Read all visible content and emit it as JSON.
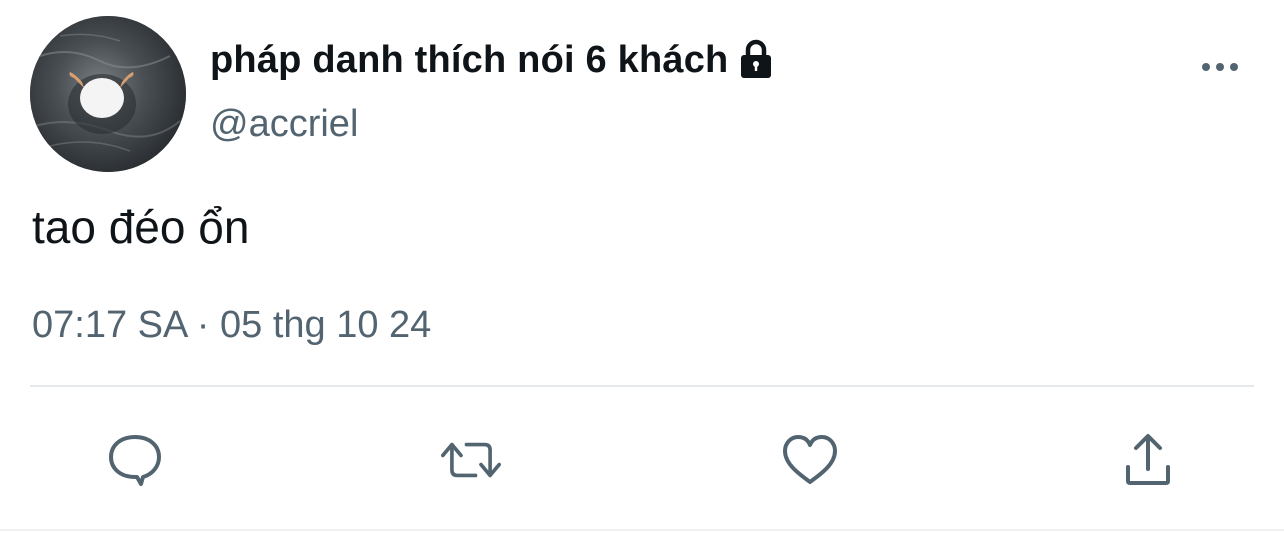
{
  "tweet": {
    "display_name": "pháp danh thích nói 6 khách",
    "handle": "@accriel",
    "text": "tao đéo ổn",
    "timestamp": "07:17 SA · 05 thg 10 24",
    "protected": true
  },
  "icons": {
    "lock": "lock-icon",
    "more": "more-horizontal-icon",
    "reply": "reply-icon",
    "retweet": "retweet-icon",
    "like": "heart-icon",
    "share": "share-icon"
  },
  "colors": {
    "text_primary": "#0f1419",
    "text_secondary": "#536471",
    "divider": "#e6e9eb"
  }
}
